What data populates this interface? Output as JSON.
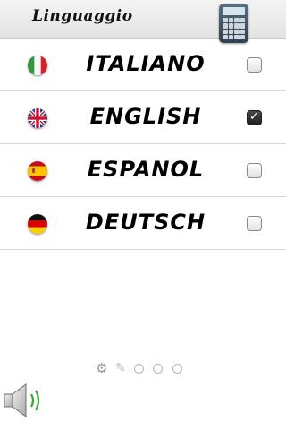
{
  "header": {
    "title": "Linguaggio",
    "calculator_icon": "calculator-icon"
  },
  "languages": [
    {
      "label": "ITALIANO",
      "flag": "italy-flag-icon",
      "checked": false
    },
    {
      "label": "ENGLISH",
      "flag": "uk-flag-icon",
      "checked": true
    },
    {
      "label": "ESPANOL",
      "flag": "spain-flag-icon",
      "checked": false
    },
    {
      "label": "DEUTSCH",
      "flag": "germany-flag-icon",
      "checked": false
    }
  ],
  "checkmark": "✓",
  "page_indicator": {
    "icons": [
      "gear-icon",
      "pin-icon"
    ],
    "dot_count": 3
  },
  "footer": {
    "speaker_icon": "speaker-sound-icon"
  },
  "colors": {
    "header_bg": "#ebebeb",
    "divider": "#d7d7d7",
    "checked_box": "#2a2a2a",
    "sound_wave": "#3fa535"
  }
}
